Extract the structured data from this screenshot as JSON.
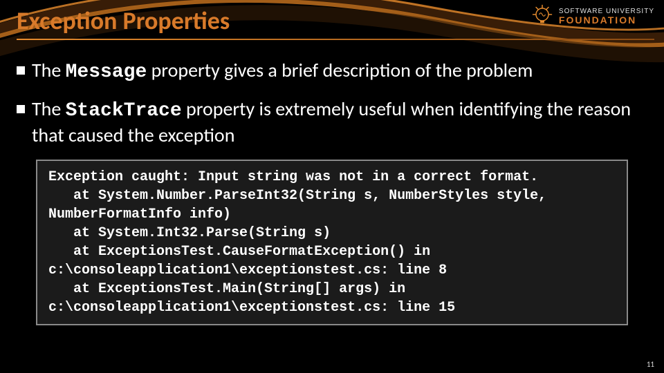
{
  "title": "Exception Properties",
  "logo": {
    "line1": "SOFTWARE UNIVERSITY",
    "line2": "FOUNDATION"
  },
  "bullets": [
    {
      "prefix": "The ",
      "mono": "Message",
      "suffix": " property gives a brief description of the problem"
    },
    {
      "prefix": "The ",
      "mono": "StackTrace",
      "suffix": " property is extremely useful when identifying the reason that caused the exception"
    }
  ],
  "code": "Exception caught: Input string was not in a correct format.\n   at System.Number.ParseInt32(String s, NumberStyles style,\nNumberFormatInfo info)\n   at System.Int32.Parse(String s)\n   at ExceptionsTest.CauseFormatException() in\nc:\\consoleapplication1\\exceptionstest.cs: line 8\n   at ExceptionsTest.Main(String[] args) in\nc:\\consoleapplication1\\exceptionstest.cs: line 15",
  "page_number": "11"
}
